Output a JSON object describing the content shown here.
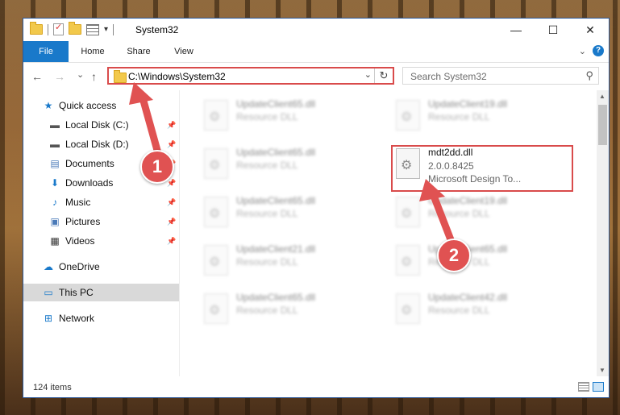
{
  "window": {
    "title": "System32",
    "controls": {
      "minimize": "—",
      "maximize": "☐",
      "close": "✕"
    }
  },
  "ribbon": {
    "tabs": [
      "File",
      "Home",
      "Share",
      "View"
    ],
    "expand_icon": "chevron-down-icon",
    "help_label": "?"
  },
  "navigation": {
    "back": "←",
    "forward": "→",
    "recent": "⌄",
    "up": "↑",
    "address": "C:\\Windows\\System32",
    "search_placeholder": "Search System32"
  },
  "sidebar": {
    "items": [
      {
        "label": "Quick access",
        "icon": "star-icon"
      },
      {
        "label": "Local Disk (C:)",
        "icon": "drive-icon",
        "pinned": true
      },
      {
        "label": "Local Disk (D:)",
        "icon": "drive-icon",
        "pinned": true
      },
      {
        "label": "Documents",
        "icon": "documents-icon",
        "pinned": true
      },
      {
        "label": "Downloads",
        "icon": "download-icon",
        "pinned": true
      },
      {
        "label": "Music",
        "icon": "music-icon",
        "pinned": true
      },
      {
        "label": "Pictures",
        "icon": "pictures-icon",
        "pinned": true
      },
      {
        "label": "Videos",
        "icon": "videos-icon",
        "pinned": true
      },
      {
        "label": "OneDrive",
        "icon": "cloud-icon"
      },
      {
        "label": "This PC",
        "icon": "computer-icon",
        "selected": true
      },
      {
        "label": "Network",
        "icon": "network-icon"
      }
    ]
  },
  "files": [
    {
      "name": "UpdateClient65.dll",
      "line2": "Resource DLL",
      "blurred": true
    },
    {
      "name": "UpdateClient19.dll",
      "line2": "Resource DLL",
      "blurred": true
    },
    {
      "name": "UpdateClient65.dll",
      "line2": "Resource DLL",
      "blurred": true
    },
    {
      "name": "mdt2dd.dll",
      "line2": "2.0.0.8425",
      "line3": "Microsoft Design To...",
      "blurred": false
    },
    {
      "name": "UpdateClient65.dll",
      "line2": "Resource DLL",
      "blurred": true
    },
    {
      "name": "UpdateClient19.dll",
      "line2": "Resource DLL",
      "blurred": true
    },
    {
      "name": "UpdateClient21.dll",
      "line2": "Resource DLL",
      "blurred": true
    },
    {
      "name": "UpdateClient65.dll",
      "line2": "Resource DLL",
      "blurred": true
    },
    {
      "name": "UpdateClient65.dll",
      "line2": "Resource DLL",
      "blurred": true
    },
    {
      "name": "UpdateClient42.dll",
      "line2": "Resource DLL",
      "blurred": true
    }
  ],
  "status": {
    "item_count": "124 items"
  },
  "annotations": {
    "badge1": "1",
    "badge2": "2",
    "color": "#e05252"
  }
}
